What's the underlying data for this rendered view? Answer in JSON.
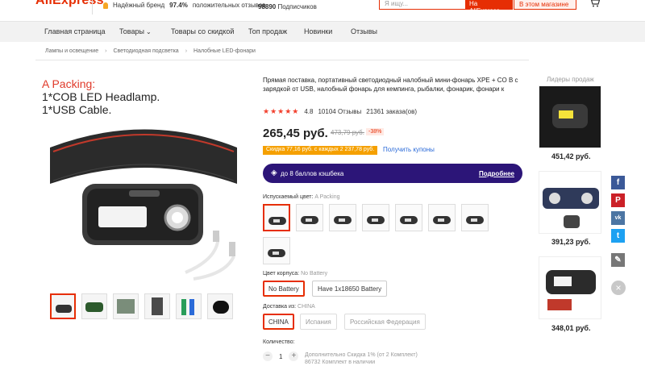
{
  "header": {
    "logo": "AliExpress",
    "brand_badge": "Надёжный бренд",
    "positive_pct": "97.4%",
    "positive_label": "положительных отзывов",
    "subscribers": "98890",
    "subscribers_label": "Подписчиков",
    "search_placeholder": "Я ищу...",
    "search_ali": "На AliExpress",
    "search_store": "В этом магазине"
  },
  "nav": {
    "items": [
      "Главная страница",
      "Товары",
      "Товары со скидкой",
      "Топ продаж",
      "Новинки",
      "Отзывы"
    ]
  },
  "breadcrumb": [
    "Лампы и освещение",
    "Светодиодная подсветка",
    "Налобные LED-фонари"
  ],
  "image": {
    "line1": "A Packing:",
    "line2": "1*COB LED Headlamp.",
    "line3": "1*USB Cable."
  },
  "product": {
    "title": "Прямая поставка, портативный светодиодный налобный мини-фонарь XPE + CO В с зарядкой от USB, налобный фонарь для кемпинга, рыбалки, фонарик, фонари к",
    "rating": "4.8",
    "reviews": "10104 Отзывы",
    "orders": "21361 заказа(ов)",
    "price": "265,45 руб.",
    "old_price": "473,79 руб.",
    "discount": "-38%",
    "coupon": "Скидка 77,16 руб. с каждых 2 237,78 руб.",
    "get_coupons": "Получить купоны",
    "cashback": "до 8 баллов кэшбека",
    "cashback_more": "Подробнее",
    "color_label": "Испускаемый цвет:",
    "color_value": "A Packing",
    "body_label": "Цвет корпуса:",
    "body_value": "No Battery",
    "body_options": [
      "No Battery",
      "Have 1x18650 Battery"
    ],
    "ship_label": "Доставка из:",
    "ship_value": "CHINA",
    "ship_options": [
      "CHINA",
      "Испания",
      "Российская Федерация"
    ],
    "qty_label": "Количество:",
    "qty": "1",
    "qty_note1": "Дополнительно Скидка 1% (от 2 Комплект)",
    "qty_note2": "86732 Комплект в наличии"
  },
  "leaders": {
    "title": "Лидеры продаж",
    "items": [
      {
        "price": "451,42 руб."
      },
      {
        "price": "391,23 руб."
      },
      {
        "price": "348,01 руб."
      }
    ]
  },
  "share": {
    "facebook": "f",
    "pinterest": "P",
    "vk": "vk",
    "twitter": "t"
  },
  "colors": {
    "accent": "#e62e04",
    "cashback_bg": "#2c1578",
    "link": "#2a6ad8"
  }
}
